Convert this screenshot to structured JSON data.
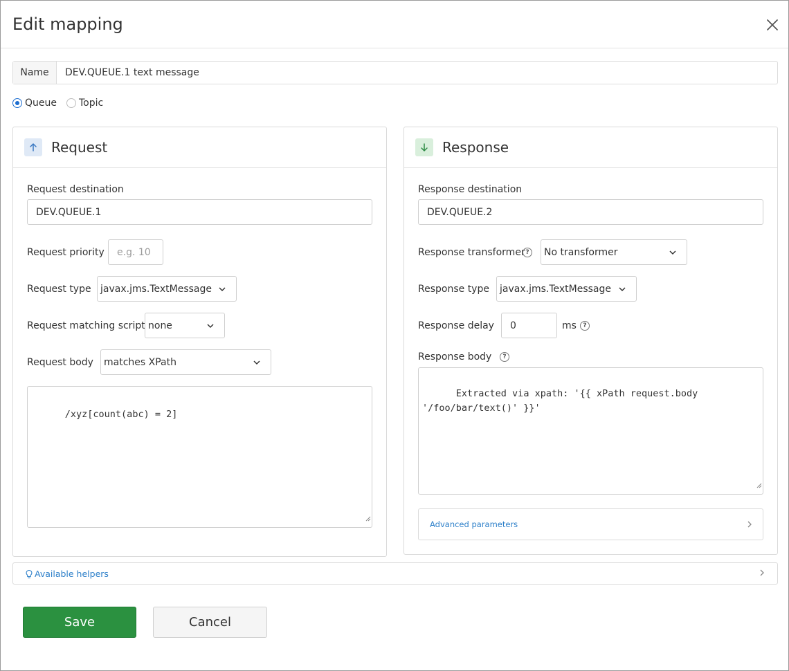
{
  "dialog": {
    "title": "Edit mapping"
  },
  "name": {
    "label": "Name",
    "value": "DEV.QUEUE.1 text message"
  },
  "destination_kind": {
    "options": [
      "Queue",
      "Topic"
    ],
    "selected": "Queue"
  },
  "request": {
    "title": "Request",
    "destination_label": "Request destination",
    "destination_value": "DEV.QUEUE.1",
    "priority_label": "Request priority",
    "priority_placeholder": "e.g. 10",
    "type_label": "Request type",
    "type_value": "javax.jms.TextMessage",
    "matching_script_label": "Request matching script",
    "matching_script_value": "none",
    "body_label": "Request body",
    "body_matcher_value": "matches XPath",
    "body_text": "/xyz[count(abc) = 2]"
  },
  "response": {
    "title": "Response",
    "destination_label": "Response destination",
    "destination_value": "DEV.QUEUE.2",
    "transformer_label": "Response transformer",
    "transformer_value": "No transformer",
    "type_label": "Response type",
    "type_value": "javax.jms.TextMessage",
    "delay_label": "Response delay",
    "delay_value": "0",
    "delay_unit": "ms",
    "body_label": "Response body",
    "body_text": "Extracted via xpath: '{{ xPath request.body\n'/foo/bar/text()' }}'",
    "advanced_label": "Advanced parameters"
  },
  "helpers": {
    "label": "Available helpers"
  },
  "actions": {
    "save_label": "Save",
    "cancel_label": "Cancel"
  },
  "colors": {
    "accent_blue": "#1c6dd0",
    "save_green": "#2b9140",
    "link_blue": "#2c7fc9"
  },
  "icons": {
    "close": "close-icon",
    "request": "arrow-up-icon",
    "response": "arrow-down-icon",
    "help": "help-circle-icon",
    "helpers": "lightbulb-icon",
    "chevron_down": "chevron-down-icon",
    "chevron_right": "chevron-right-icon"
  }
}
